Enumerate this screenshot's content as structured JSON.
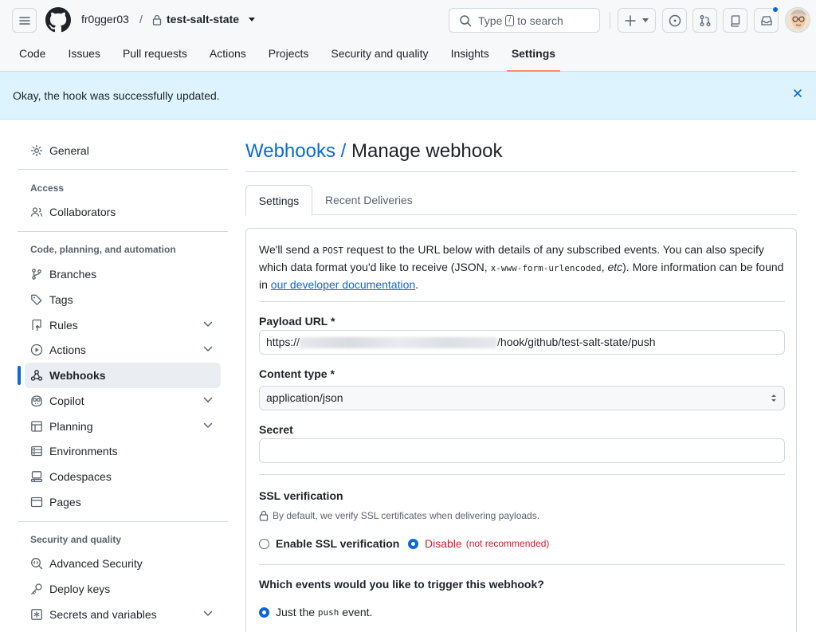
{
  "header": {
    "owner": "fr0gger03",
    "separator": "/",
    "repo": "test-salt-state",
    "search_prefix": "Type",
    "search_key": "/",
    "search_suffix": "to search"
  },
  "nav": {
    "items": [
      "Code",
      "Issues",
      "Pull requests",
      "Actions",
      "Projects",
      "Security and quality",
      "Insights",
      "Settings"
    ],
    "active": "Settings"
  },
  "flash": {
    "message": "Okay, the hook was successfully updated."
  },
  "sidebar": {
    "general": "General",
    "access_heading": "Access",
    "collaborators": "Collaborators",
    "code_heading": "Code, planning, and automation",
    "branches": "Branches",
    "tags": "Tags",
    "rules": "Rules",
    "actions": "Actions",
    "webhooks": "Webhooks",
    "copilot": "Copilot",
    "planning": "Planning",
    "environments": "Environments",
    "codespaces": "Codespaces",
    "pages": "Pages",
    "security_heading": "Security and quality",
    "advanced_security": "Advanced Security",
    "deploy_keys": "Deploy keys",
    "secrets": "Secrets and variables"
  },
  "main": {
    "breadcrumb_link": "Webhooks",
    "breadcrumb_sep": " / ",
    "title": "Manage webhook",
    "tabs": [
      "Settings",
      "Recent Deliveries"
    ],
    "intro_1": "We'll send a ",
    "intro_post": "POST",
    "intro_2": " request to the URL below with details of any subscribed events. You can also specify which data format you'd like to receive (JSON, ",
    "intro_form": "x-www-form-urlencoded",
    "intro_3": ", ",
    "intro_etc": "etc",
    "intro_4": "). More information can be found in ",
    "intro_link": "our developer documentation",
    "intro_5": ".",
    "payload_label": "Payload URL *",
    "payload_prefix": "https://",
    "payload_suffix": "/hook/github/test-salt-state/push",
    "content_label": "Content type *",
    "content_value": "application/json",
    "secret_label": "Secret",
    "secret_value": "",
    "ssl_label": "SSL verification",
    "ssl_hint": "By default, we verify SSL certificates when delivering payloads.",
    "ssl_enable": "Enable SSL verification",
    "ssl_disable": "Disable",
    "ssl_disable_note": "(not recommended)",
    "events_label": "Which events would you like to trigger this webhook?",
    "events_opt_1": "Just the ",
    "events_opt_push": "push",
    "events_opt_2": " event."
  },
  "colors": {
    "accent": "#0969da",
    "danger": "#cf222e",
    "flash_bg": "#ddf4ff",
    "nav_underline": "#fd8c73"
  }
}
